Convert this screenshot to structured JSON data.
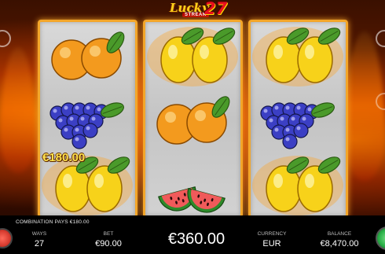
{
  "game": {
    "logo": {
      "lucky": "Lucky",
      "streak": "STREAK",
      "number": "27"
    }
  },
  "reels": [
    [
      "orange",
      "grapes",
      "lemon"
    ],
    [
      "lemon",
      "orange",
      "watermelon"
    ],
    [
      "lemon",
      "grapes",
      "lemon"
    ]
  ],
  "win_label": "€180.00",
  "status": {
    "combination": "COMBINATION PAYS €180.00",
    "ways_label": "WAYS",
    "ways_value": "27",
    "bet_label": "BET",
    "bet_value": "€90.00",
    "total_win": "€360.00",
    "currency_label": "CURRENCY",
    "currency_value": "EUR",
    "balance_label": "BALANCE",
    "balance_value": "€8,470.00"
  },
  "colors": {
    "reel_frame": "#f3a62a",
    "win_text": "#ffe24d",
    "spin_button": "#2bb24a",
    "menu_button": "#d63b2f"
  }
}
